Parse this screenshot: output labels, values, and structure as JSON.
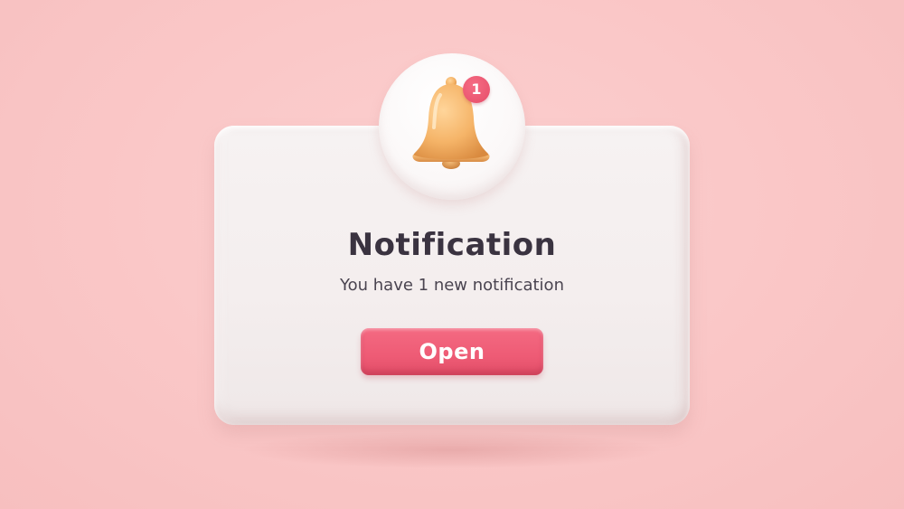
{
  "notification": {
    "title": "Notification",
    "message": "You have 1 new notification",
    "open_label": "Open",
    "badge_count": "1"
  },
  "icons": {
    "bell": "bell-icon"
  },
  "colors": {
    "background": "#fac8c8",
    "card": "#f4eeee",
    "accent_button": "#ee5b75",
    "badge": "#e64c68",
    "bell": "#f2b366",
    "title_text": "#3a3340"
  }
}
